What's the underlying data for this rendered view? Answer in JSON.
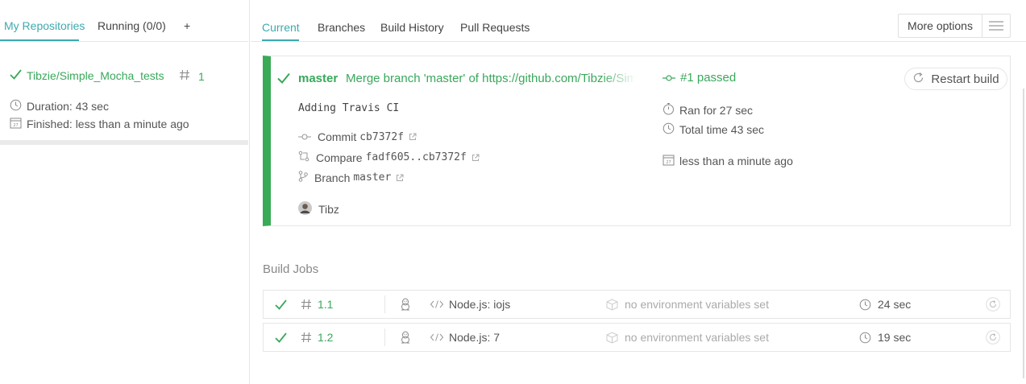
{
  "sidebar": {
    "tabs": [
      {
        "label": "My Repositories",
        "active": true
      },
      {
        "label": "Running (0/0)",
        "active": false
      },
      {
        "label": "+",
        "active": false
      }
    ],
    "repo": {
      "name": "Tibzie/Simple_Mocha_tests",
      "build_number": "1",
      "duration": "Duration: 43 sec",
      "finished": "Finished: less than a minute ago",
      "status_color": "#39a85b"
    }
  },
  "main": {
    "tabs": [
      {
        "label": "Current",
        "active": true
      },
      {
        "label": "Branches",
        "active": false
      },
      {
        "label": "Build History",
        "active": false
      },
      {
        "label": "Pull Requests",
        "active": false
      }
    ],
    "more_options_label": "More options"
  },
  "build": {
    "branch": "master",
    "commit_message": "Merge branch 'master' of https://github.com/Tibzie/Simple_Mocha_tests",
    "description": "Adding Travis CI",
    "commit_label": "Commit",
    "commit_sha": "cb7372f",
    "compare_label": "Compare",
    "compare_range": "fadf605..cb7372f",
    "branch_label": "Branch",
    "branch_name": "master",
    "author": "Tibz",
    "status": "#1 passed",
    "ran_for": "Ran for 27 sec",
    "total_time": "Total time 43 sec",
    "finished": "less than a minute ago",
    "restart_label": "Restart build",
    "accent_color": "#39aa56"
  },
  "jobs": {
    "title": "Build Jobs",
    "items": [
      {
        "number": "1.1",
        "language": "Node.js: iojs",
        "env": "no environment variables set",
        "duration": "24 sec",
        "os_icon": "linux-tux-icon"
      },
      {
        "number": "1.2",
        "language": "Node.js: 7",
        "env": "no environment variables set",
        "duration": "19 sec",
        "os_icon": "linux-tux-icon"
      }
    ]
  }
}
